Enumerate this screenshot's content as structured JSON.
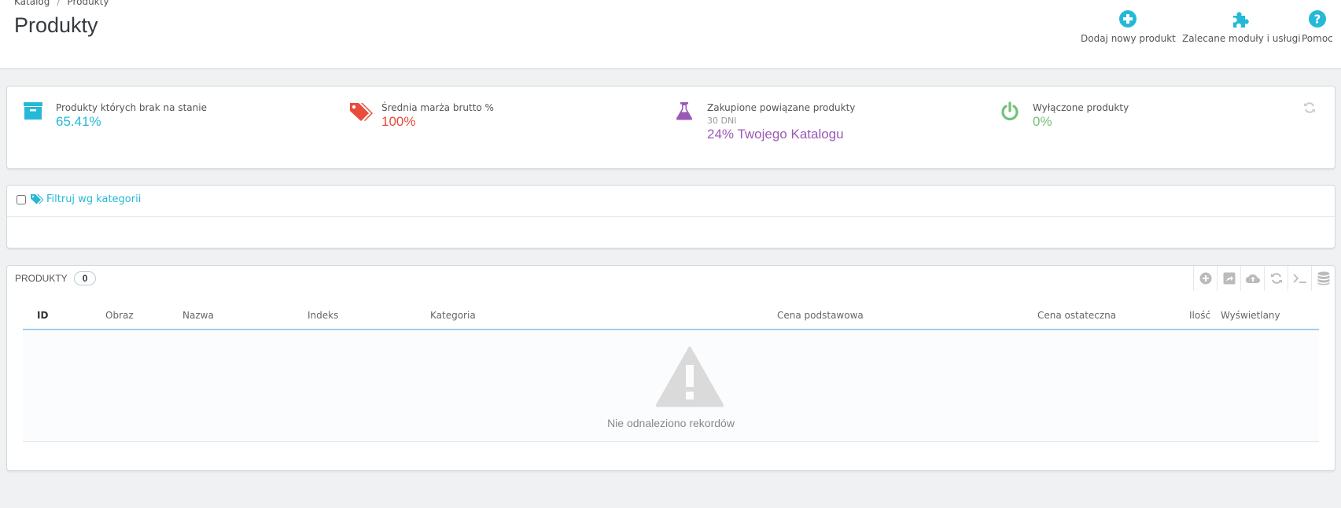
{
  "breadcrumb": {
    "parent": "Katalog",
    "separator": "/",
    "current": "Produkty"
  },
  "page_title": "Produkty",
  "toolbar": {
    "add_product": "Dodaj nowy produkt",
    "recommended_modules": "Zalecane moduły i usługi",
    "help": "Pomoc"
  },
  "kpis": {
    "out_of_stock": {
      "title": "Produkty których brak na stanie",
      "value": "65.41%",
      "icon": "archive-box-icon",
      "color": "#25b9d7"
    },
    "avg_margin": {
      "title": "Średnia marża brutto %",
      "value": "100%",
      "icon": "tags-icon",
      "color": "#e74c3c"
    },
    "purchased_related": {
      "title": "Zakupione powiązane produkty",
      "subtitle": "30 DNI",
      "value": "24% Twojego Katalogu",
      "icon": "flask-icon",
      "color": "#9b59b6"
    },
    "disabled_products": {
      "title": "Wyłączone produkty",
      "value": "0%",
      "icon": "power-icon",
      "color": "#72c279"
    }
  },
  "filter": {
    "label": "Filtruj wg kategorii"
  },
  "list": {
    "title": "Produkty",
    "count": "0",
    "columns": {
      "id": "ID",
      "image": "Obraz",
      "name": "Nazwa",
      "reference": "Indeks",
      "category": "Kategoria",
      "base_price": "Cena podstawowa",
      "final_price": "Cena ostateczna",
      "quantity": "Ilość",
      "status": "Wyświetlany"
    },
    "empty_message": "Nie odnaleziono rekordów"
  },
  "colors": {
    "accent": "#25b9d7",
    "header_line": "#a0d0eb"
  }
}
